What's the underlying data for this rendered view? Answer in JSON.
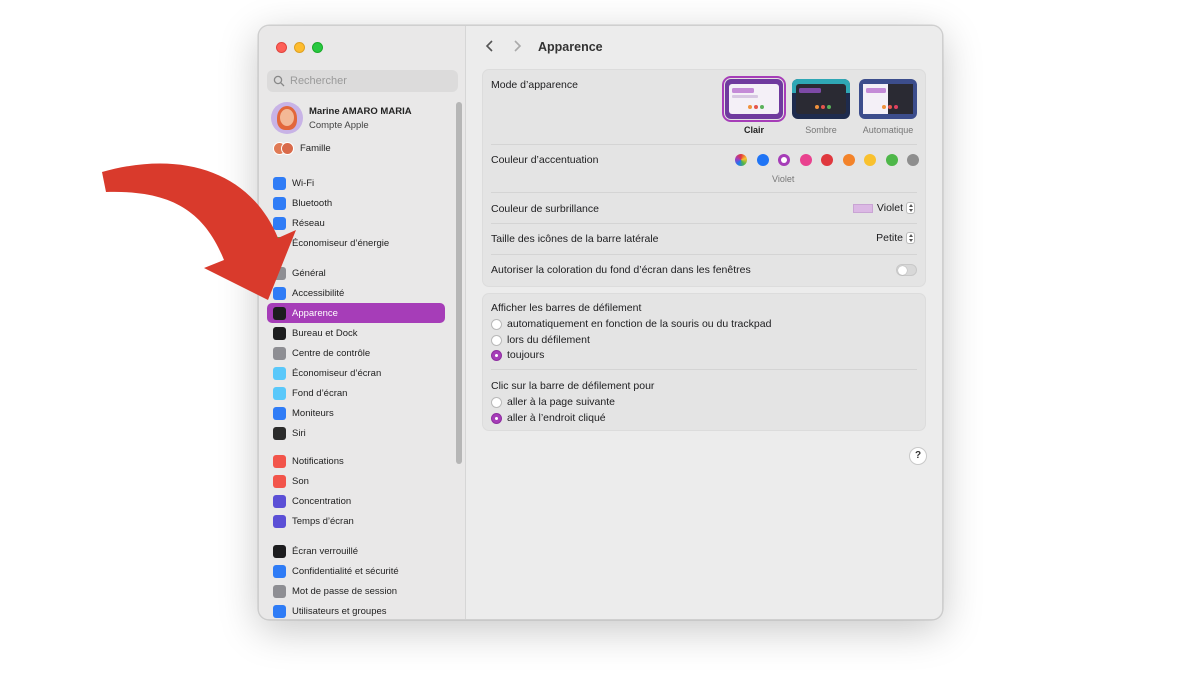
{
  "window": {
    "title": "Apparence"
  },
  "search": {
    "placeholder": "Rechercher"
  },
  "account": {
    "name": "Marine AMARO MARIA",
    "subtitle": "Compte Apple",
    "family_label": "Famille"
  },
  "sidebar": {
    "items": [
      {
        "label": "Wi-Fi",
        "icon": "wifi-icon",
        "color": "#2f7cf6"
      },
      {
        "label": "Bluetooth",
        "icon": "bluetooth-icon",
        "color": "#2f7cf6"
      },
      {
        "label": "Réseau",
        "icon": "network-icon",
        "color": "#2f7cf6"
      },
      {
        "label": "Économiseur d’énergie",
        "icon": "battery-icon",
        "color": "#3cba54"
      },
      {
        "label": "Général",
        "icon": "gear-icon",
        "color": "#8e8e93"
      },
      {
        "label": "Accessibilité",
        "icon": "accessibility-icon",
        "color": "#2f7cf6"
      },
      {
        "label": "Apparence",
        "icon": "appearance-icon",
        "color": "#1d1d1f",
        "active": true
      },
      {
        "label": "Bureau et Dock",
        "icon": "dock-icon",
        "color": "#1d1d1f"
      },
      {
        "label": "Centre de contrôle",
        "icon": "control-center-icon",
        "color": "#8e8e93"
      },
      {
        "label": "Économiseur d’écran",
        "icon": "screensaver-icon",
        "color": "#5ac8fa"
      },
      {
        "label": "Fond d’écran",
        "icon": "wallpaper-icon",
        "color": "#5ac8fa"
      },
      {
        "label": "Moniteurs",
        "icon": "display-icon",
        "color": "#2f7cf6"
      },
      {
        "label": "Siri",
        "icon": "siri-icon",
        "color": "#2b2b2b"
      },
      {
        "label": "Notifications",
        "icon": "notifications-icon",
        "color": "#f2544a"
      },
      {
        "label": "Son",
        "icon": "sound-icon",
        "color": "#f2544a"
      },
      {
        "label": "Concentration",
        "icon": "focus-icon",
        "color": "#5b4fd6"
      },
      {
        "label": "Temps d’écran",
        "icon": "screen-time-icon",
        "color": "#5b4fd6"
      },
      {
        "label": "Écran verrouillé",
        "icon": "lock-screen-icon",
        "color": "#1d1d1f"
      },
      {
        "label": "Confidentialité et sécurité",
        "icon": "privacy-icon",
        "color": "#2f7cf6"
      },
      {
        "label": "Mot de passe de session",
        "icon": "password-icon",
        "color": "#8e8e93"
      },
      {
        "label": "Utilisateurs et groupes",
        "icon": "users-icon",
        "color": "#2f7cf6"
      }
    ]
  },
  "appearance": {
    "mode_label": "Mode d’apparence",
    "modes": [
      {
        "label": "Clair",
        "selected": true
      },
      {
        "label": "Sombre",
        "selected": false
      },
      {
        "label": "Automatique",
        "selected": false
      }
    ],
    "accent_label": "Couleur d’accentuation",
    "accent_colors": [
      "multicolor",
      "#1f74f5",
      "#a63db8",
      "#e9428f",
      "#e0383e",
      "#f3832a",
      "#f9c12e",
      "#4eb749",
      "#8e8e8e"
    ],
    "accent_selected_name": "Violet",
    "highlight_label": "Couleur de surbrillance",
    "highlight_value": "Violet",
    "sidebar_icon_label": "Taille des icônes de la barre latérale",
    "sidebar_icon_value": "Petite",
    "tinting_label": "Autoriser la coloration du fond d’écran dans les fenêtres",
    "tinting_enabled": false
  },
  "scrollbars": {
    "show_label": "Afficher les barres de défilement",
    "show_options": [
      {
        "label": "automatiquement en fonction de la souris ou du trackpad",
        "selected": false
      },
      {
        "label": "lors du défilement",
        "selected": false
      },
      {
        "label": "toujours",
        "selected": true
      }
    ],
    "click_label": "Clic sur la barre de défilement pour",
    "click_options": [
      {
        "label": "aller à la page suivante",
        "selected": false
      },
      {
        "label": "aller à l’endroit cliqué",
        "selected": true
      }
    ]
  },
  "help": {
    "label": "?"
  },
  "colors": {
    "accent": "#a63db8",
    "arrow": "#d93a2c"
  }
}
